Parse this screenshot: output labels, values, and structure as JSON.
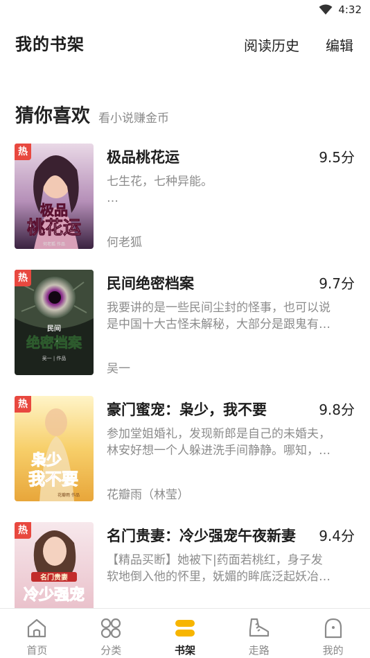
{
  "status_bar": {
    "time": "4:32"
  },
  "header": {
    "title": "我的书架",
    "history_label": "阅读历史",
    "edit_label": "编辑"
  },
  "section": {
    "title": "猜你喜欢",
    "subtitle": "看小说赚金币"
  },
  "hot_badge": "热",
  "books": [
    {
      "title": "极品桃花运",
      "score": "9.5分",
      "desc_lines": [
        "七生花，七种异能。",
        "…"
      ],
      "author": "何老狐",
      "cover_text": [
        "极品",
        "桃花运"
      ],
      "cover_caption": "何老狐 作品"
    },
    {
      "title": "民间绝密档案",
      "score": "9.7分",
      "desc_lines": [
        "我要讲的是一些民间尘封的怪事，也可以说",
        "是中国十大古怪未解秘，大部分是跟鬼有…"
      ],
      "author": "吴一",
      "cover_text": [
        "民间",
        "绝密档案"
      ],
      "cover_caption": "吴一 | 作品"
    },
    {
      "title": "豪门蜜宠：枭少，我不要",
      "score": "9.8分",
      "desc_lines": [
        "参加堂姐婚礼，发现新郎是自己的未婚夫，",
        "林安好想一个人躲进洗手间静静。哪知，…"
      ],
      "author": "花瓣雨（林莹）",
      "cover_text": [
        "枭少",
        "我不要"
      ],
      "cover_caption": "花瓣雨 作品"
    },
    {
      "title": "名门贵妻：冷少强宠午夜新妻",
      "score": "9.4分",
      "desc_lines": [
        "【精品买断】她被下|药面若桃红，身子发",
        "软地倒入他的怀里，妩媚的眸底泛起妖冶…"
      ],
      "author": "",
      "cover_text": [
        "名门贵妻",
        "冷少强宠"
      ],
      "cover_caption": ""
    }
  ],
  "tabs": [
    {
      "label": "首页",
      "icon": "home-icon",
      "active": false
    },
    {
      "label": "分类",
      "icon": "category-icon",
      "active": false
    },
    {
      "label": "书架",
      "icon": "bookshelf-icon",
      "active": true
    },
    {
      "label": "走路",
      "icon": "shoe-icon",
      "active": false
    },
    {
      "label": "我的",
      "icon": "profile-icon",
      "active": false
    }
  ],
  "colors": {
    "accent": "#f7b500",
    "hot_badge": "#e8483f",
    "text_primary": "#1d1d1d",
    "text_secondary": "#8c8c8c"
  }
}
